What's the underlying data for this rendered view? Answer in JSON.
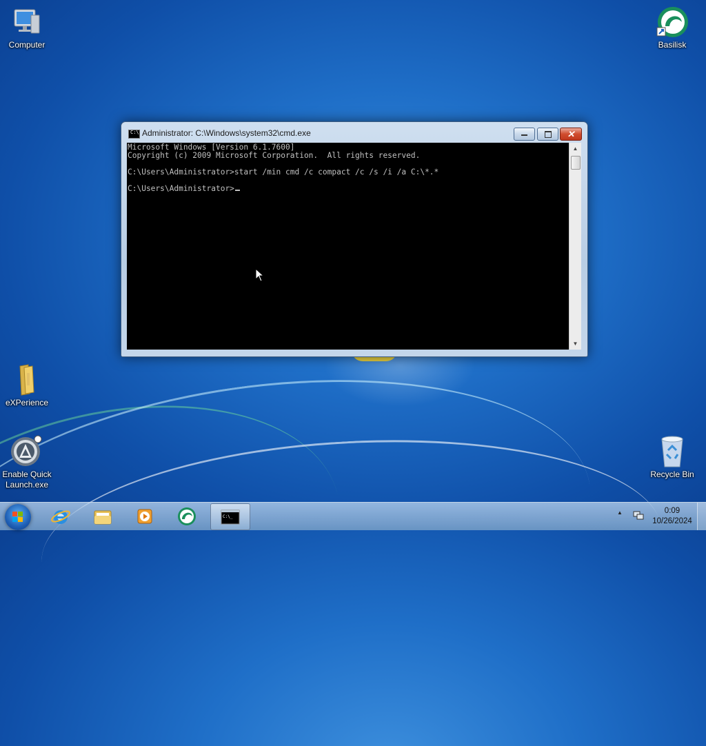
{
  "desktop": {
    "icons": {
      "computer": "Computer",
      "basilisk": "Basilisk",
      "experience": "eXPerience",
      "enable_quick_launch": "Enable Quick\nLaunch.exe",
      "recycle_bin": "Recycle Bin"
    }
  },
  "window": {
    "icon_text": "C:\\",
    "title": "Administrator: C:\\Windows\\system32\\cmd.exe",
    "close_glyph": "✕",
    "console_lines": [
      "Microsoft Windows [Version 6.1.7600]",
      "Copyright (c) 2009 Microsoft Corporation.  All rights reserved.",
      "",
      "C:\\Users\\Administrator>start /min cmd /c compact /c /s /i /a C:\\*.*",
      "",
      "C:\\Users\\Administrator>"
    ],
    "scroll_up_glyph": "▲",
    "scroll_down_glyph": "▼"
  },
  "taskbar": {
    "tray_chevron": "▲",
    "clock_time": "0:09",
    "clock_date": "10/26/2024",
    "cmd_icon_text": "C:\\_"
  },
  "colors": {
    "console_bg": "#000000",
    "console_text": "#c0c0c0",
    "desktop_accent": "#1f6fc8"
  }
}
